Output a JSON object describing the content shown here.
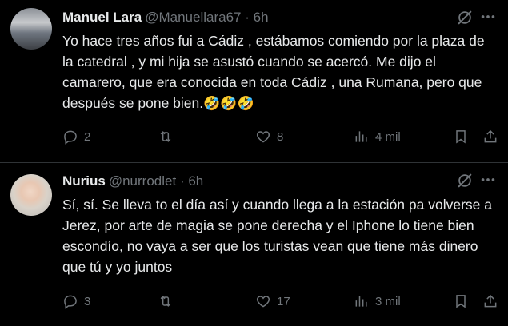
{
  "tweets": [
    {
      "name": "Manuel Lara",
      "handle": "@Manuellara67",
      "dot": "·",
      "time": "6h",
      "text": "Yo hace tres años fui a Cádiz , estábamos comiendo por la plaza de la catedral , y mi hija se asustó cuando se acercó. Me dijo el camarero, que era conocida en toda Cádiz , una Rumana, pero que después se pone bien.",
      "emoji": "🤣🤣🤣",
      "replies": "2",
      "reposts": "",
      "likes": "8",
      "views": "4 mil",
      "icons": {
        "more": "more-horizontal-icon",
        "grok": "grok-icon",
        "reply": "reply-icon",
        "repost": "repost-icon",
        "like": "heart-icon",
        "views": "views-icon",
        "bookmark": "bookmark-icon",
        "share": "share-icon"
      }
    },
    {
      "name": "Nurius",
      "handle": "@nurrodlet",
      "dot": "·",
      "time": "6h",
      "text": "Sí, sí. Se lleva to el día así y cuando llega a la estación pa volverse a Jerez, por arte de magia se pone derecha y el Iphone lo tiene bien escondío, no vaya a ser que los turistas vean que tiene más dinero que tú y yo juntos",
      "replies": "3",
      "reposts": "",
      "likes": "17",
      "views": "3 mil"
    }
  ],
  "colors": {
    "background": "#000000",
    "text": "#e7e9ea",
    "muted": "#71767b",
    "divider": "#2f3336"
  }
}
